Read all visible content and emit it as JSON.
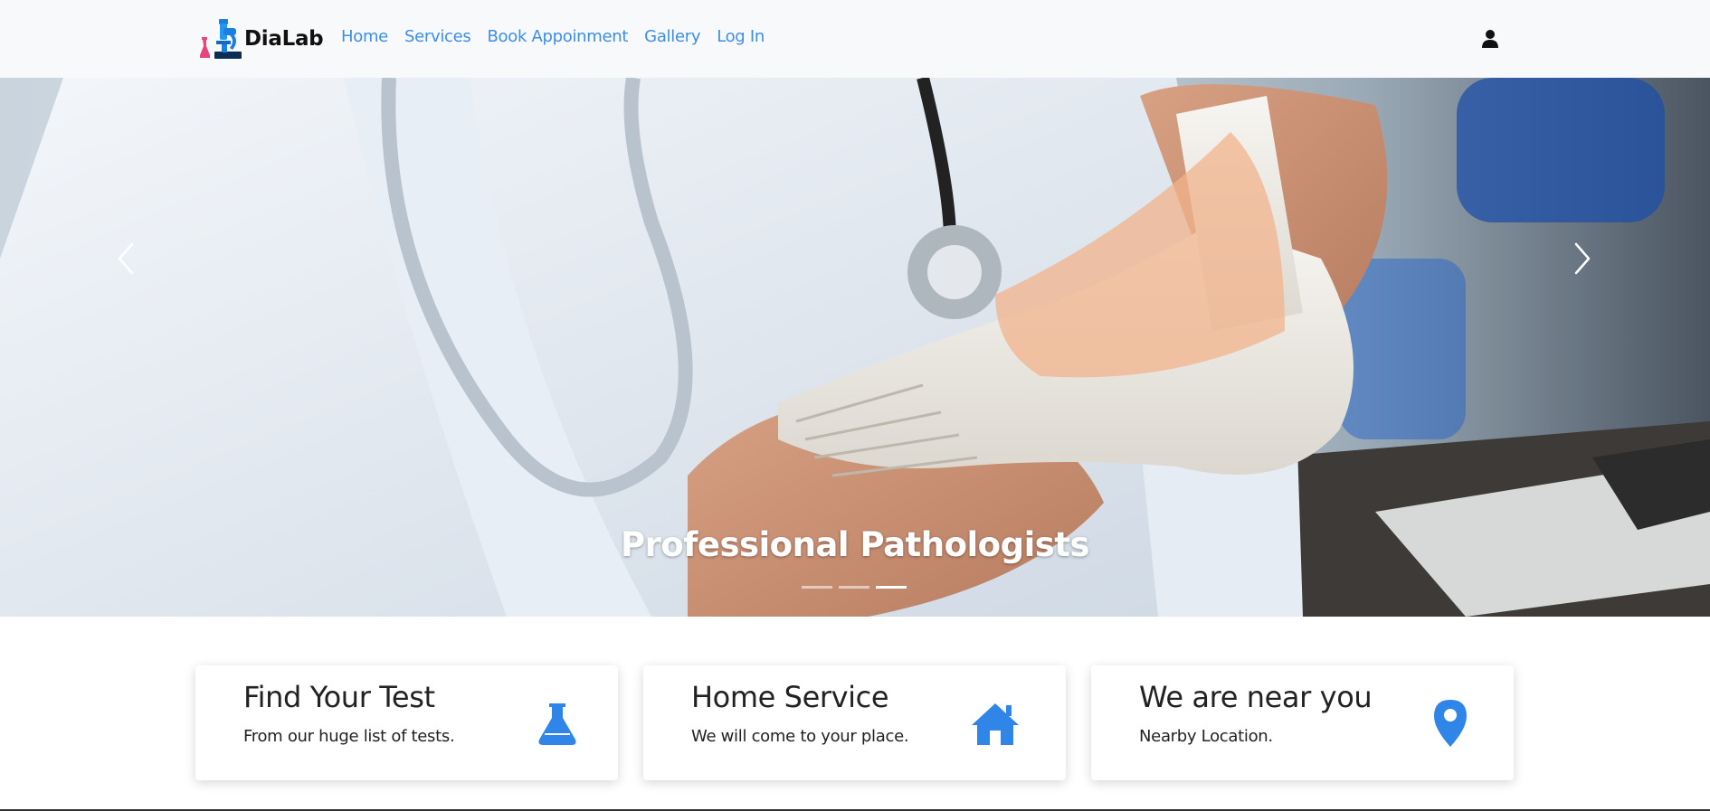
{
  "brand": {
    "name": "DiaLab",
    "logo_icon": "microscope-flask-logo"
  },
  "nav": {
    "items": [
      {
        "label": "Home"
      },
      {
        "label": "Services"
      },
      {
        "label": "Book Appoinment"
      },
      {
        "label": "Gallery"
      },
      {
        "label": "Log In"
      }
    ],
    "user_icon": "user-icon"
  },
  "carousel": {
    "caption": "Professional Pathologists",
    "slide_count": 3,
    "active_index": 2,
    "prev_icon": "chevron-left-icon",
    "next_icon": "chevron-right-icon"
  },
  "features": [
    {
      "title": "Find Your Test",
      "text": "From our huge list of tests.",
      "icon": "flask-icon"
    },
    {
      "title": "Home Service",
      "text": "We will come to your place.",
      "icon": "home-icon"
    },
    {
      "title": "We are near you",
      "text": "Nearby Location.",
      "icon": "map-marker-icon"
    }
  ],
  "colors": {
    "accent": "#2f86e8",
    "nav_link": "#3d8ee6",
    "navbar_bg": "#f8f9fa"
  }
}
